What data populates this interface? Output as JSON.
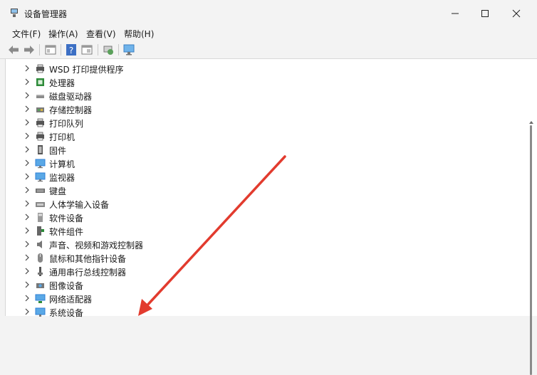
{
  "window": {
    "title": "设备管理器"
  },
  "menubar": {
    "items": [
      "文件(F)",
      "操作(A)",
      "查看(V)",
      "帮助(H)"
    ]
  },
  "tree": {
    "items": [
      {
        "label": "WSD 打印提供程序",
        "icon": "printer-icon"
      },
      {
        "label": "处理器",
        "icon": "processor-icon"
      },
      {
        "label": "磁盘驱动器",
        "icon": "disk-drive-icon"
      },
      {
        "label": "存储控制器",
        "icon": "storage-controller-icon"
      },
      {
        "label": "打印队列",
        "icon": "print-queue-icon"
      },
      {
        "label": "打印机",
        "icon": "printer-icon"
      },
      {
        "label": "固件",
        "icon": "firmware-icon"
      },
      {
        "label": "计算机",
        "icon": "computer-icon"
      },
      {
        "label": "监视器",
        "icon": "monitor-icon"
      },
      {
        "label": "键盘",
        "icon": "keyboard-icon"
      },
      {
        "label": "人体学输入设备",
        "icon": "hid-icon"
      },
      {
        "label": "软件设备",
        "icon": "software-device-icon"
      },
      {
        "label": "软件组件",
        "icon": "software-component-icon"
      },
      {
        "label": "声音、视频和游戏控制器",
        "icon": "speaker-icon"
      },
      {
        "label": "鼠标和其他指针设备",
        "icon": "mouse-icon"
      },
      {
        "label": "通用串行总线控制器",
        "icon": "usb-icon"
      },
      {
        "label": "图像设备",
        "icon": "camera-icon"
      },
      {
        "label": "网络适配器",
        "icon": "network-adapter-icon"
      },
      {
        "label": "系统设备",
        "icon": "system-device-icon"
      }
    ]
  },
  "colors": {
    "annotation_arrow": "#e23b2e",
    "icon_blue": "#2f7fd6",
    "icon_green": "#2e8b3a"
  }
}
